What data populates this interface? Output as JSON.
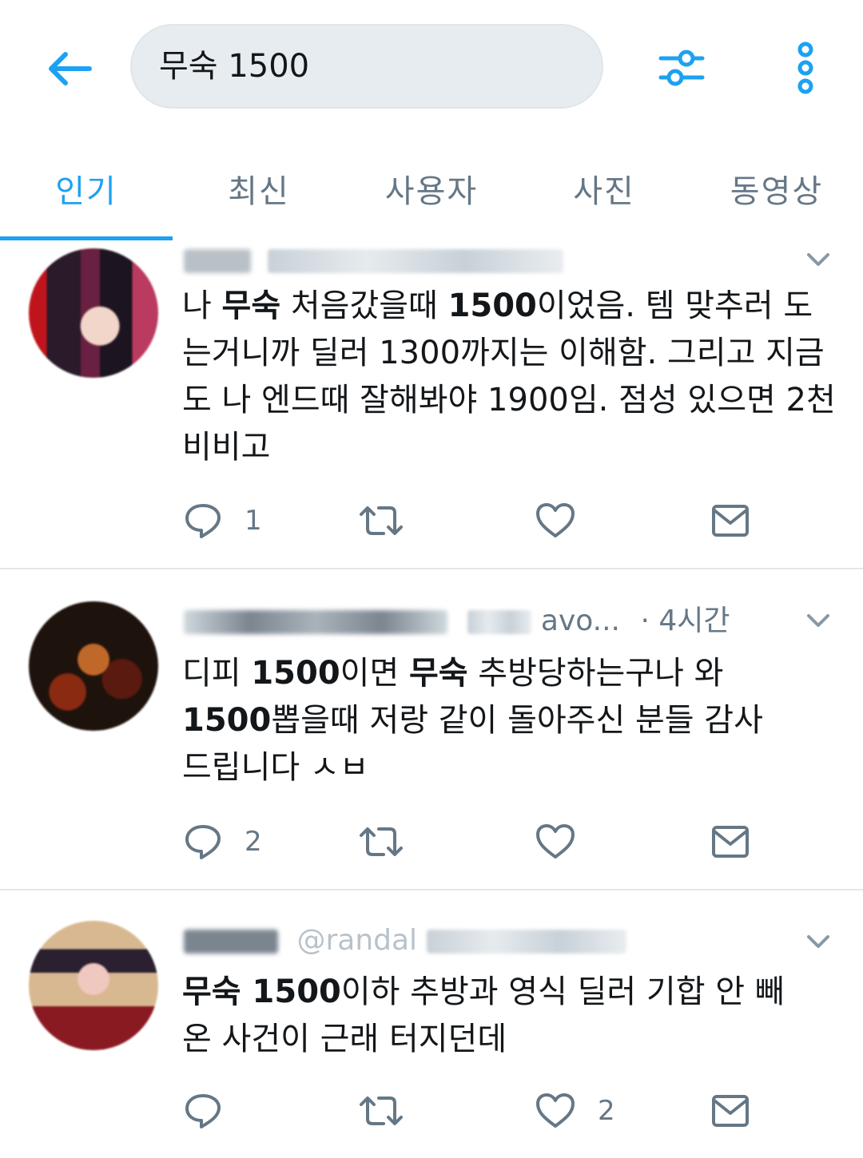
{
  "header": {
    "search_value": "무숙 1500"
  },
  "tabs": [
    {
      "label": "인기"
    },
    {
      "label": "최신"
    },
    {
      "label": "사용자"
    },
    {
      "label": "사진"
    },
    {
      "label": "동영상"
    }
  ],
  "tweets": [
    {
      "time": "",
      "text": {
        "p1": "나 ",
        "b1": "무숙",
        "p2": " 처음갔을때 ",
        "b2": "1500",
        "p3": "이었음. 템 맞추러 도는거니까 딜러 1300까지는 이해함. 그리고 지금도 나 엔드때 잘해봐야 1900임. 점성 있으면 2천 비비고"
      },
      "reply_count": "1",
      "retweet_count": "",
      "like_count": ""
    },
    {
      "time": "· 4시간",
      "handle_visible": "avo...",
      "text": {
        "p1": "디피 ",
        "b1": "1500",
        "p2": "이면 ",
        "b2": "무숙",
        "p3": " 추방당하는구나 와 ",
        "b3": "1500",
        "p4": "뽑을때 저랑 같이 돌아주신 분들 감사드립니다 ㅅㅂ"
      },
      "reply_count": "2",
      "retweet_count": "",
      "like_count": ""
    },
    {
      "time": "",
      "handle_visible": "@randal",
      "text": {
        "b1": "무숙 1500",
        "p1": "이하 추방과 영식 딜러 기합 안 빼온 사건이 근래 터지던데"
      },
      "reply_count": "",
      "retweet_count": "",
      "like_count": "2"
    }
  ],
  "colors": {
    "accent": "#1da1f2",
    "secondary_text": "#657786",
    "divider": "#e1e8ed",
    "search_bg": "#e6ecf0"
  },
  "icons": [
    "back-arrow-icon",
    "filter-icon",
    "more-vertical-icon",
    "chevron-down-icon",
    "reply-icon",
    "retweet-icon",
    "like-icon",
    "dm-icon"
  ]
}
